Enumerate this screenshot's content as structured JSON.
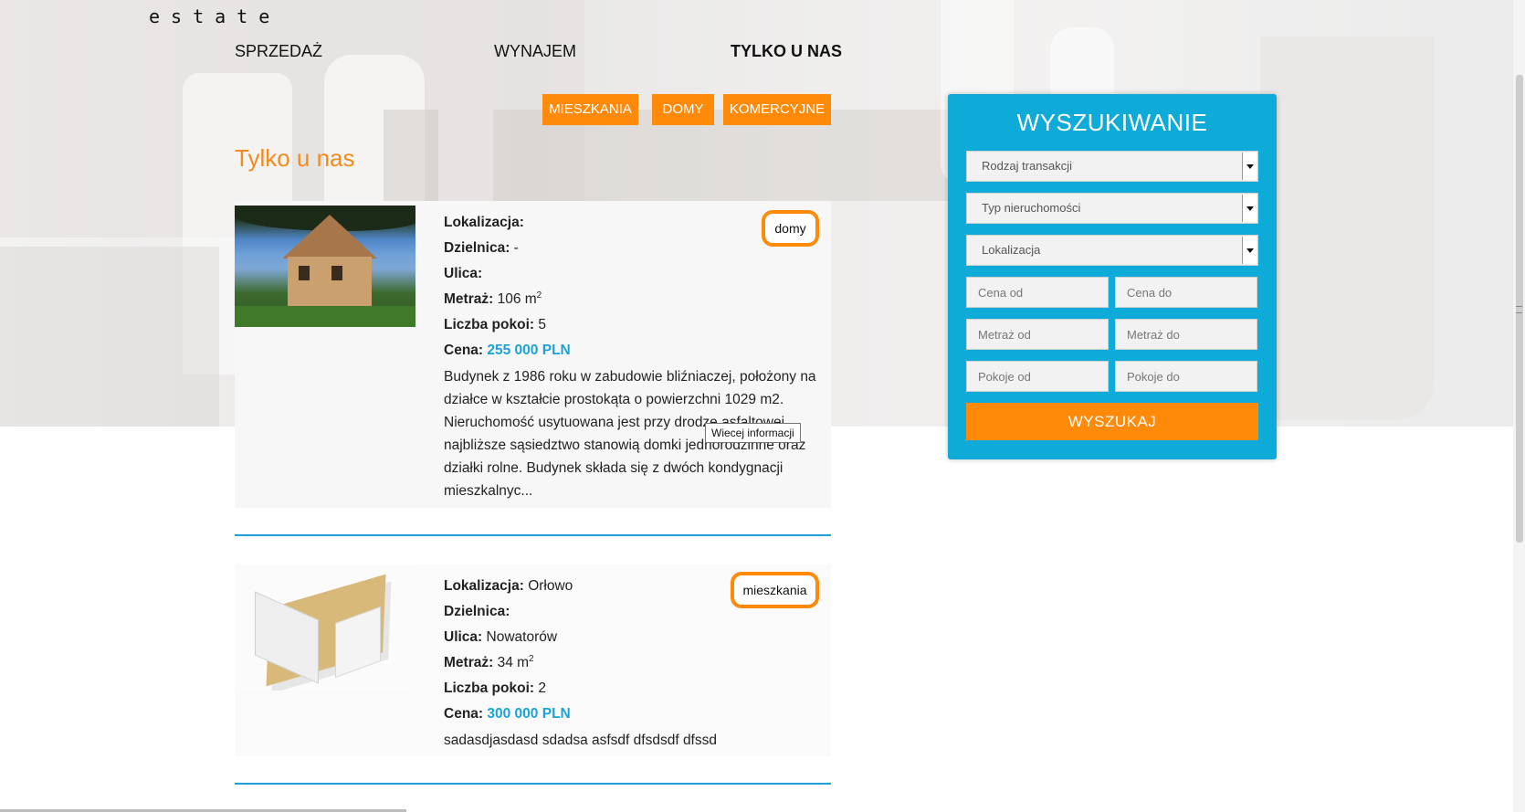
{
  "brand": {
    "logo_text": "estate"
  },
  "nav": {
    "items": [
      "SPRZEDAŻ",
      "WYNAJEM",
      "TYLKO U NAS"
    ],
    "active": "TYLKO U NAS"
  },
  "categories": [
    "MIESZKANIA",
    "DOMY",
    "KOMERCYJNE"
  ],
  "section_title": "Tylko u nas",
  "labels": {
    "location": "Lokalizacja:",
    "district": "Dzielnica:",
    "street": "Ulica:",
    "area": "Metraż:",
    "rooms": "Liczba pokoi:",
    "price": "Cena:"
  },
  "listings": [
    {
      "type_tag": "domy",
      "location": "",
      "district": "-",
      "street": "",
      "area": "106 m",
      "area_sup": "2",
      "rooms": "5",
      "price": "255 000 PLN",
      "description_lines": [
        "Budynek z 1986 roku w zabudowie bliźniaczej, położony na",
        "działce w kształcie prostokąta o powierzchni 1029 m2.",
        "Nieruchomość usytuowana jest przy drodze asfaltowej,",
        "najbliższe sąsiedztwo stanowią domki jednorodzinne oraz",
        "działki rolne. Budynek składa się z dwóch kondygnacji",
        "mieszkalnyc..."
      ],
      "tooltip": "Wiecej informacji",
      "image": "house-photo"
    },
    {
      "type_tag": "mieszkania",
      "location": "Orłowo",
      "district": "",
      "street": "Nowatorów",
      "area": "34 m",
      "area_sup": "2",
      "rooms": "2",
      "price": "300 000 PLN",
      "description": "sadasdjasdasd sdadsa asfsdf dfsdsdf dfssd",
      "image": "apartment-floorplan"
    }
  ],
  "search": {
    "title": "WYSZUKIWANIE",
    "selects": [
      "Rodzaj transakcji",
      "Typ nieruchomości",
      "Lokalizacja"
    ],
    "inputs": {
      "price_from": "Cena od",
      "price_to": "Cena do",
      "area_from": "Metraż od",
      "area_to": "Metraż do",
      "rooms_from": "Pokoje od",
      "rooms_to": "Pokoje do"
    },
    "button": "WYSZUKAJ"
  },
  "colors": {
    "accent_orange": "#ff8a0a",
    "title_orange": "#f28a1e",
    "panel_blue": "#0eaad8",
    "price_blue": "#1ba3d8"
  }
}
